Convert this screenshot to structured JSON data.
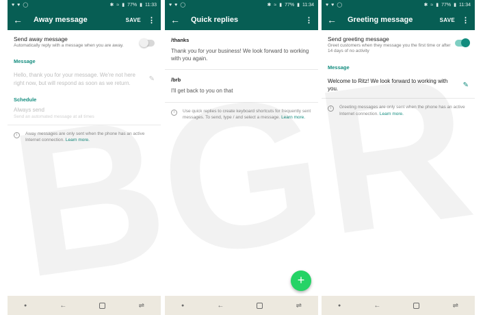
{
  "status": {
    "left_icons": [
      "twitter-icon",
      "heart-icon",
      "whatsapp-icon"
    ],
    "battery": "77%",
    "times": [
      "11:33",
      "11:34",
      "11:34"
    ]
  },
  "screen1": {
    "title": "Away message",
    "save": "SAVE",
    "setting_title": "Send away message",
    "setting_sub": "Automatically reply with a message when you are away.",
    "message_label": "Message",
    "message_text": "Hello, thank you for your message. We're not here right now, but will respond as soon as we return.",
    "schedule_label": "Schedule",
    "schedule_title": "Always send",
    "schedule_sub": "Send an automated message at all times",
    "info_text": "Away messages are only sent when the phone has an active Internet connection.",
    "info_link": "Learn more."
  },
  "screen2": {
    "title": "Quick replies",
    "replies": [
      {
        "shortcut": "/thanks",
        "text": "Thank you for your business! We look forward to working with you again."
      },
      {
        "shortcut": "/brb",
        "text": "I'll get back to you on that"
      }
    ],
    "info_text": "Use quick replies to create keyboard shortcuts for frequently sent messages. To send, type / and select a message.",
    "info_link": "Learn more.",
    "fab": "+"
  },
  "screen3": {
    "title": "Greeting message",
    "save": "SAVE",
    "setting_title": "Send greeting message",
    "setting_sub": "Greet customers when they message you the first time or after 14 days of no activity",
    "message_label": "Message",
    "message_text": "Welcome to Ritz! We look forward to working with you.",
    "info_text": "Greeting messages are only sent when the phone has an active Internet connection.",
    "info_link": "Learn more."
  },
  "watermark": "BGR",
  "colors": {
    "primary": "#075e54",
    "accent": "#128c7e",
    "fab": "#25d366"
  }
}
